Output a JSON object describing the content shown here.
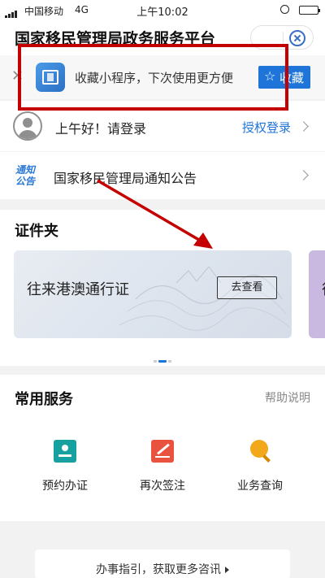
{
  "status_bar": {
    "carrier": "中国移动",
    "network": "4G",
    "time": "上午10:02"
  },
  "nav": {
    "title": "国家移民管理局政务服务平台"
  },
  "favorite_bar": {
    "message": "收藏小程序，下次使用更方便",
    "button_label": "收藏",
    "close_icon": "close-icon",
    "app_icon": "app-logo-icon"
  },
  "login_row": {
    "greeting": "上午好！请登录",
    "auth_link": "授权登录"
  },
  "notice_row": {
    "icon_text_line1": "通知",
    "icon_text_line2": "公告",
    "label": "国家移民管理局通知公告"
  },
  "cards": {
    "title": "证件夹",
    "card_name": "往来港澳通行证",
    "view_button": "去查看",
    "next_card_name": "往"
  },
  "services": {
    "title": "常用服务",
    "help_link": "帮助说明",
    "items": [
      {
        "label": "预约办证",
        "icon": "appointment-icon",
        "color": "#17a0a0"
      },
      {
        "label": "再次签注",
        "icon": "sign-icon",
        "color": "#e9523f"
      },
      {
        "label": "业务查询",
        "icon": "search-icon",
        "color": "#f1a91b"
      }
    ]
  },
  "guide": {
    "label": "办事指引，获取更多咨讯"
  },
  "colors": {
    "accent": "#1e74d9",
    "annotation": "#c40000"
  }
}
